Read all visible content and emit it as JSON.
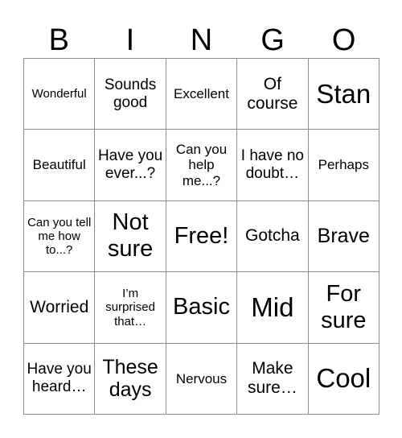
{
  "header": {
    "letters": [
      "B",
      "I",
      "N",
      "G",
      "O"
    ]
  },
  "card": {
    "rows": [
      [
        "Wonderful",
        "Sounds good",
        "Excellent",
        "Of course",
        "Stan"
      ],
      [
        "Beautiful",
        "Have you ever...?",
        "Can you help me...?",
        "I have no doubt…",
        "Perhaps"
      ],
      [
        "Can you tell me how to...?",
        "Not sure",
        "Free!",
        "Gotcha",
        "Brave"
      ],
      [
        "Worried",
        "I’m surprised that…",
        "Basic",
        "Mid",
        "For sure"
      ],
      [
        "Have you heard…",
        "These days",
        "Nervous",
        "Make sure…",
        "Cool"
      ]
    ]
  }
}
